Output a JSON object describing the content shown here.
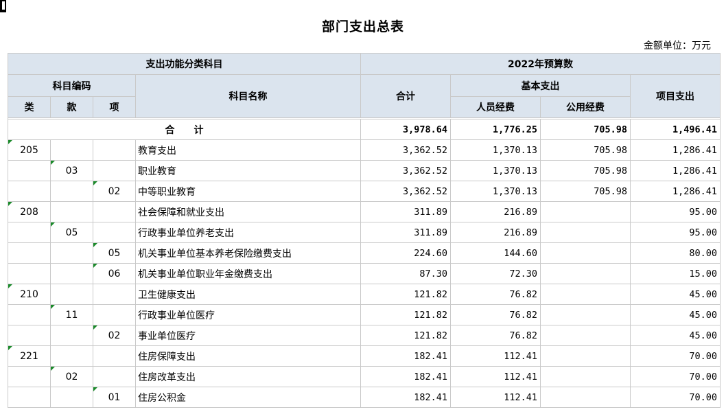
{
  "title": "部门支出总表",
  "unit_label": "金额单位：万元",
  "header": {
    "category_group": "支出功能分类科目",
    "budget_group": "2022年预算数",
    "code_group": "科目编码",
    "name": "科目名称",
    "total": "合计",
    "basic_group": "基本支出",
    "project": "项目支出",
    "lei": "类",
    "kuan": "款",
    "xiang": "项",
    "personnel": "人员经费",
    "public": "公用经费"
  },
  "total_row": {
    "label": "合　　计",
    "total": "3,978.64",
    "personnel": "1,776.25",
    "public": "705.98",
    "project": "1,496.41"
  },
  "rows": [
    {
      "lei": "205",
      "kuan": "",
      "xiang": "",
      "name": "教育支出",
      "total": "3,362.52",
      "personnel": "1,370.13",
      "public": "705.98",
      "project": "1,286.41"
    },
    {
      "lei": "",
      "kuan": "03",
      "xiang": "",
      "name": "职业教育",
      "total": "3,362.52",
      "personnel": "1,370.13",
      "public": "705.98",
      "project": "1,286.41"
    },
    {
      "lei": "",
      "kuan": "",
      "xiang": "02",
      "name": "中等职业教育",
      "total": "3,362.52",
      "personnel": "1,370.13",
      "public": "705.98",
      "project": "1,286.41"
    },
    {
      "lei": "208",
      "kuan": "",
      "xiang": "",
      "name": "社会保障和就业支出",
      "total": "311.89",
      "personnel": "216.89",
      "public": "",
      "project": "95.00"
    },
    {
      "lei": "",
      "kuan": "05",
      "xiang": "",
      "name": "行政事业单位养老支出",
      "total": "311.89",
      "personnel": "216.89",
      "public": "",
      "project": "95.00"
    },
    {
      "lei": "",
      "kuan": "",
      "xiang": "05",
      "name": "机关事业单位基本养老保险缴费支出",
      "total": "224.60",
      "personnel": "144.60",
      "public": "",
      "project": "80.00"
    },
    {
      "lei": "",
      "kuan": "",
      "xiang": "06",
      "name": "机关事业单位职业年金缴费支出",
      "total": "87.30",
      "personnel": "72.30",
      "public": "",
      "project": "15.00"
    },
    {
      "lei": "210",
      "kuan": "",
      "xiang": "",
      "name": "卫生健康支出",
      "total": "121.82",
      "personnel": "76.82",
      "public": "",
      "project": "45.00"
    },
    {
      "lei": "",
      "kuan": "11",
      "xiang": "",
      "name": "行政事业单位医疗",
      "total": "121.82",
      "personnel": "76.82",
      "public": "",
      "project": "45.00"
    },
    {
      "lei": "",
      "kuan": "",
      "xiang": "02",
      "name": "事业单位医疗",
      "total": "121.82",
      "personnel": "76.82",
      "public": "",
      "project": "45.00"
    },
    {
      "lei": "221",
      "kuan": "",
      "xiang": "",
      "name": "住房保障支出",
      "total": "182.41",
      "personnel": "112.41",
      "public": "",
      "project": "70.00"
    },
    {
      "lei": "",
      "kuan": "02",
      "xiang": "",
      "name": "住房改革支出",
      "total": "182.41",
      "personnel": "112.41",
      "public": "",
      "project": "70.00"
    },
    {
      "lei": "",
      "kuan": "",
      "xiang": "01",
      "name": "住房公积金",
      "total": "182.41",
      "personnel": "112.41",
      "public": "",
      "project": "70.00"
    }
  ],
  "colors": {
    "header_bg": "#dbe4ee",
    "grid": "#c9c9c9",
    "tick": "#1a8a2a"
  }
}
